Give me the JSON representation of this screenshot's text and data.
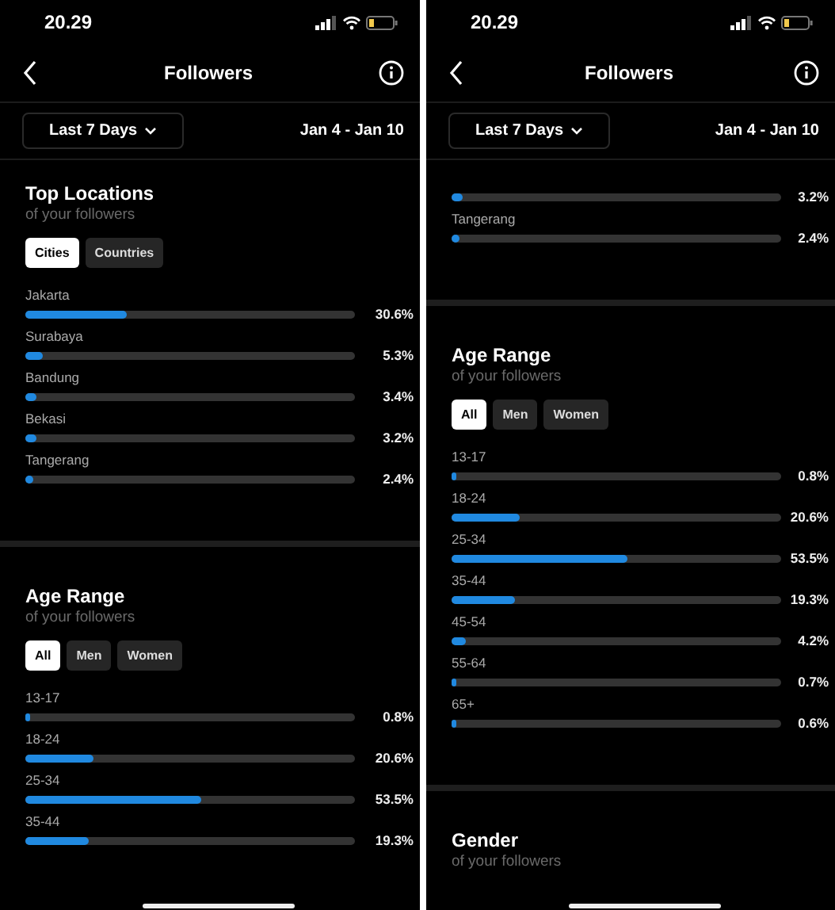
{
  "screens": [
    {
      "time": "20.29",
      "title": "Followers",
      "range_button": "Last 7 Days",
      "date_range": "Jan 4 - Jan 10",
      "blocks": [
        {
          "kind": "section",
          "title": "Top Locations",
          "subtitle": "of your followers",
          "chips": [
            {
              "label": "Cities",
              "selected": true
            },
            {
              "label": "Countries",
              "selected": false
            }
          ],
          "rows": [
            {
              "label": "Jakarta",
              "level": 0.306,
              "reading": "30.6%"
            },
            {
              "label": "Surabaya",
              "level": 0.053,
              "reading": "5.3%"
            },
            {
              "label": "Bandung",
              "level": 0.034,
              "reading": "3.4%"
            },
            {
              "label": "Bekasi",
              "level": 0.032,
              "reading": "3.2%"
            },
            {
              "label": "Tangerang",
              "level": 0.024,
              "reading": "2.4%"
            }
          ]
        },
        {
          "kind": "divider"
        },
        {
          "kind": "section",
          "title": "Age Range",
          "subtitle": "of your followers",
          "chips": [
            {
              "label": "All",
              "selected": true
            },
            {
              "label": "Men",
              "selected": false
            },
            {
              "label": "Women",
              "selected": false
            }
          ],
          "rows": [
            {
              "label": "13-17",
              "level": 0.008,
              "reading": "0.8%"
            },
            {
              "label": "18-24",
              "level": 0.206,
              "reading": "20.6%"
            },
            {
              "label": "25-34",
              "level": 0.535,
              "reading": "53.5%"
            },
            {
              "label": "35-44",
              "level": 0.193,
              "reading": "19.3%"
            }
          ]
        }
      ]
    },
    {
      "time": "20.29",
      "title": "Followers",
      "range_button": "Last 7 Days",
      "date_range": "Jan 4 - Jan 10",
      "blocks": [
        {
          "kind": "rows",
          "rows": [
            {
              "level": 0.032,
              "reading": "3.2%"
            },
            {
              "label": "Tangerang",
              "level": 0.024,
              "reading": "2.4%"
            }
          ]
        },
        {
          "kind": "divider"
        },
        {
          "kind": "section",
          "title": "Age Range",
          "subtitle": "of your followers",
          "chips": [
            {
              "label": "All",
              "selected": true
            },
            {
              "label": "Men",
              "selected": false
            },
            {
              "label": "Women",
              "selected": false
            }
          ],
          "rows": [
            {
              "label": "13-17",
              "level": 0.008,
              "reading": "0.8%"
            },
            {
              "label": "18-24",
              "level": 0.206,
              "reading": "20.6%"
            },
            {
              "label": "25-34",
              "level": 0.535,
              "reading": "53.5%"
            },
            {
              "label": "35-44",
              "level": 0.193,
              "reading": "19.3%"
            },
            {
              "label": "45-54",
              "level": 0.042,
              "reading": "4.2%"
            },
            {
              "label": "55-64",
              "level": 0.007,
              "reading": "0.7%"
            },
            {
              "label": "65+",
              "level": 0.006,
              "reading": "0.6%"
            }
          ]
        },
        {
          "kind": "divider"
        },
        {
          "kind": "section",
          "title": "Gender",
          "subtitle": "of your followers"
        }
      ]
    }
  ]
}
